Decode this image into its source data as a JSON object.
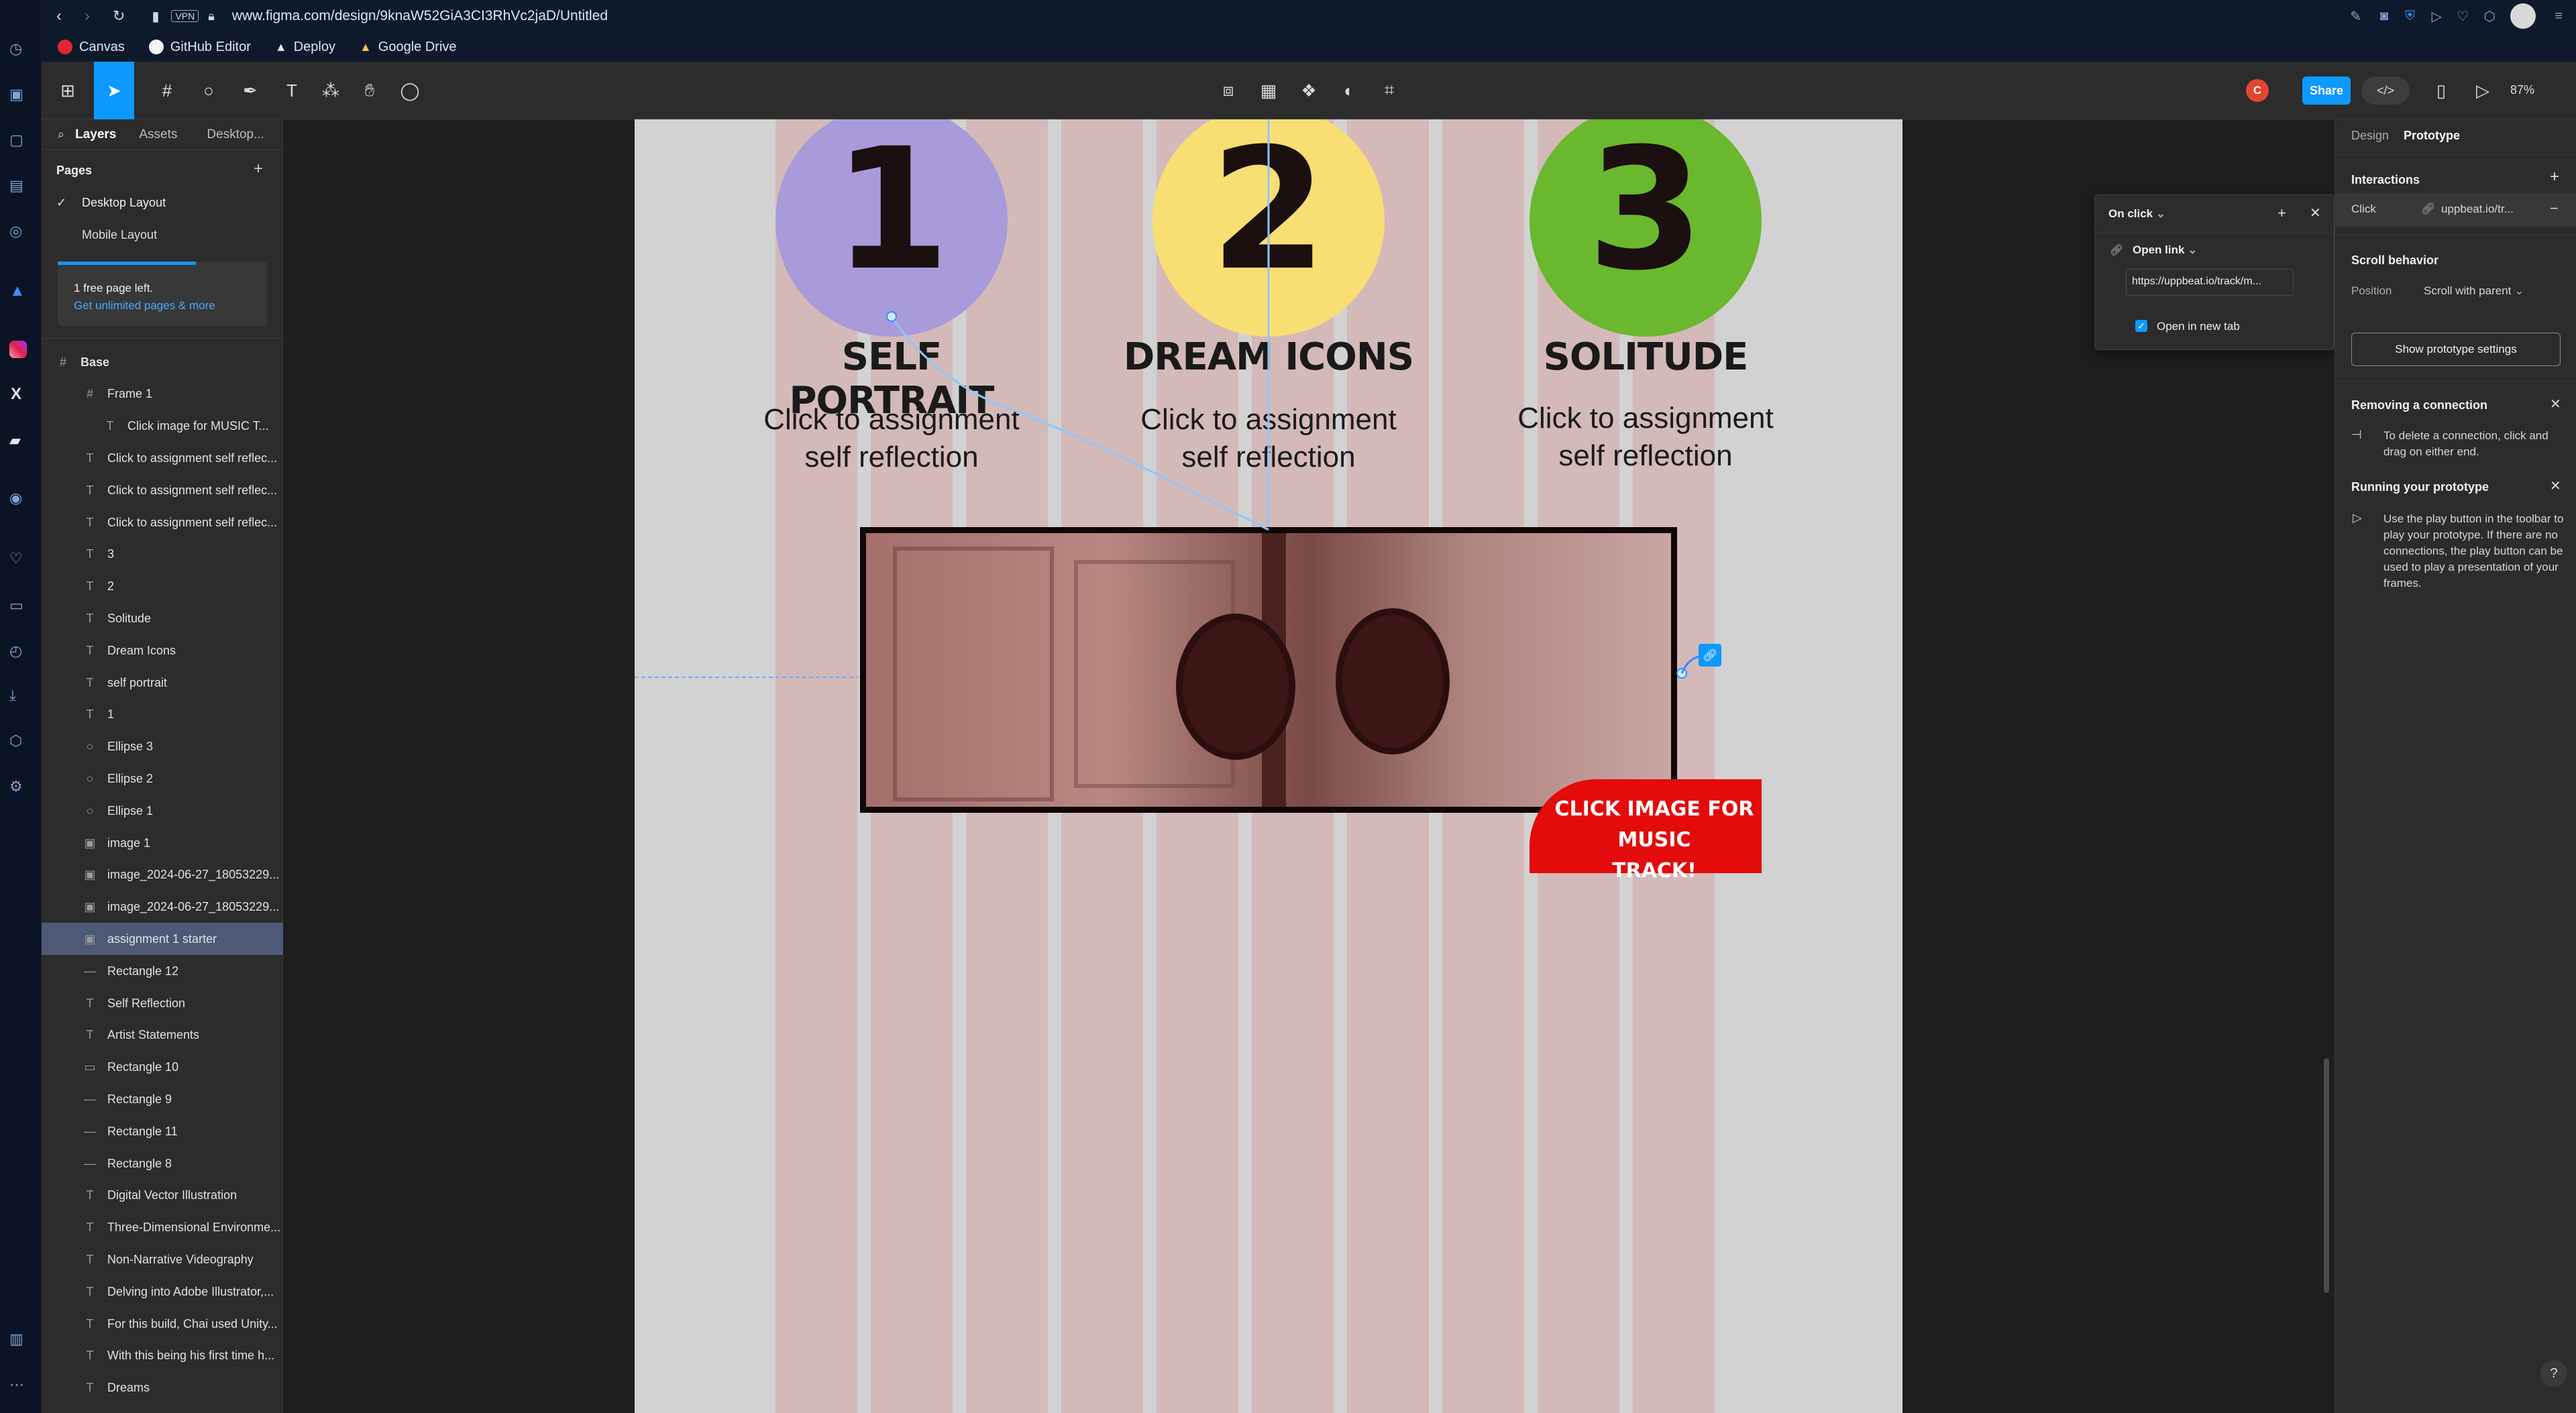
{
  "browser": {
    "url": "www.figma.com/design/9knaW52GiA3CI3RhVc2jaD/Untitled",
    "vpn": "VPN",
    "bookmarks": [
      "Canvas",
      "GitHub Editor",
      "Deploy",
      "Google Drive"
    ]
  },
  "toolbar": {
    "share": "Share",
    "zoom": "87%",
    "avatar_initial": "C"
  },
  "left_panel": {
    "tabs": [
      "Layers",
      "Assets",
      "Desktop..."
    ],
    "pages_title": "Pages",
    "pages": [
      "Desktop Layout",
      "Mobile Layout"
    ],
    "notice": "1 free page left.",
    "notice_link": "Get unlimited pages & more",
    "layers": [
      {
        "icon": "#",
        "label": "Base"
      },
      {
        "icon": "#",
        "label": "Frame 1"
      },
      {
        "icon": "T",
        "label": "Click image for MUSIC T..."
      },
      {
        "icon": "T",
        "label": "Click to assignment self reflec..."
      },
      {
        "icon": "T",
        "label": "Click to assignment self reflec..."
      },
      {
        "icon": "T",
        "label": "Click to assignment self reflec..."
      },
      {
        "icon": "T",
        "label": "3"
      },
      {
        "icon": "T",
        "label": "2"
      },
      {
        "icon": "T",
        "label": "Solitude"
      },
      {
        "icon": "T",
        "label": "Dream Icons"
      },
      {
        "icon": "T",
        "label": "self portrait"
      },
      {
        "icon": "T",
        "label": "1"
      },
      {
        "icon": "○",
        "label": "Ellipse 3"
      },
      {
        "icon": "○",
        "label": "Ellipse 2"
      },
      {
        "icon": "○",
        "label": "Ellipse 1"
      },
      {
        "icon": "▣",
        "label": "image 1"
      },
      {
        "icon": "▣",
        "label": "image_2024-06-27_18053229..."
      },
      {
        "icon": "▣",
        "label": "image_2024-06-27_18053229..."
      },
      {
        "icon": "▣",
        "label": "assignment 1 starter"
      },
      {
        "icon": "—",
        "label": "Rectangle 12"
      },
      {
        "icon": "T",
        "label": "Self Reflection"
      },
      {
        "icon": "T",
        "label": "Artist Statements"
      },
      {
        "icon": "▭",
        "label": "Rectangle 10"
      },
      {
        "icon": "—",
        "label": "Rectangle 9"
      },
      {
        "icon": "—",
        "label": "Rectangle 11"
      },
      {
        "icon": "—",
        "label": "Rectangle 8"
      },
      {
        "icon": "T",
        "label": "Digital Vector Illustration"
      },
      {
        "icon": "T",
        "label": "Three-Dimensional Environme..."
      },
      {
        "icon": "T",
        "label": "Non-Narrative Videography"
      },
      {
        "icon": "T",
        "label": "Delving into Adobe Illustrator,..."
      },
      {
        "icon": "T",
        "label": "For this build, Chai used Unity..."
      },
      {
        "icon": "T",
        "label": "With this being his first time h..."
      },
      {
        "icon": "T",
        "label": "Dreams"
      }
    ]
  },
  "canvas": {
    "items": [
      {
        "number": "1",
        "title": "SELF PORTRAIT",
        "sub1": "Click to assignment",
        "sub2": "self reflection",
        "color": "#a99ad9"
      },
      {
        "number": "2",
        "title": "DREAM ICONS",
        "sub1": "Click to assignment",
        "sub2": "self reflection",
        "color": "#f8de73"
      },
      {
        "number": "3",
        "title": "SOLITUDE",
        "sub1": "Click to assignment",
        "sub2": "self reflection",
        "color": "#6ab82e"
      }
    ],
    "cta_line1": "CLICK IMAGE FOR MUSIC",
    "cta_line2": "TRACK!"
  },
  "popup": {
    "trigger": "On click",
    "action": "Open link",
    "url": "https://uppbeat.io/track/m...",
    "checkbox_label": "Open in new tab"
  },
  "right_panel": {
    "tabs": [
      "Design",
      "Prototype"
    ],
    "interactions_title": "Interactions",
    "interaction_trigger": "Click",
    "interaction_target": "uppbeat.io/tr...",
    "scroll_title": "Scroll behavior",
    "position_label": "Position",
    "position_value": "Scroll with parent",
    "proto_settings_button": "Show prototype settings",
    "remove_title": "Removing a connection",
    "remove_text": "To delete a connection, click and drag on either end.",
    "run_title": "Running your prototype",
    "run_text": "Use the play button in the toolbar to play your prototype. If there are no connections, the play button can be used to play a presentation of your frames."
  }
}
